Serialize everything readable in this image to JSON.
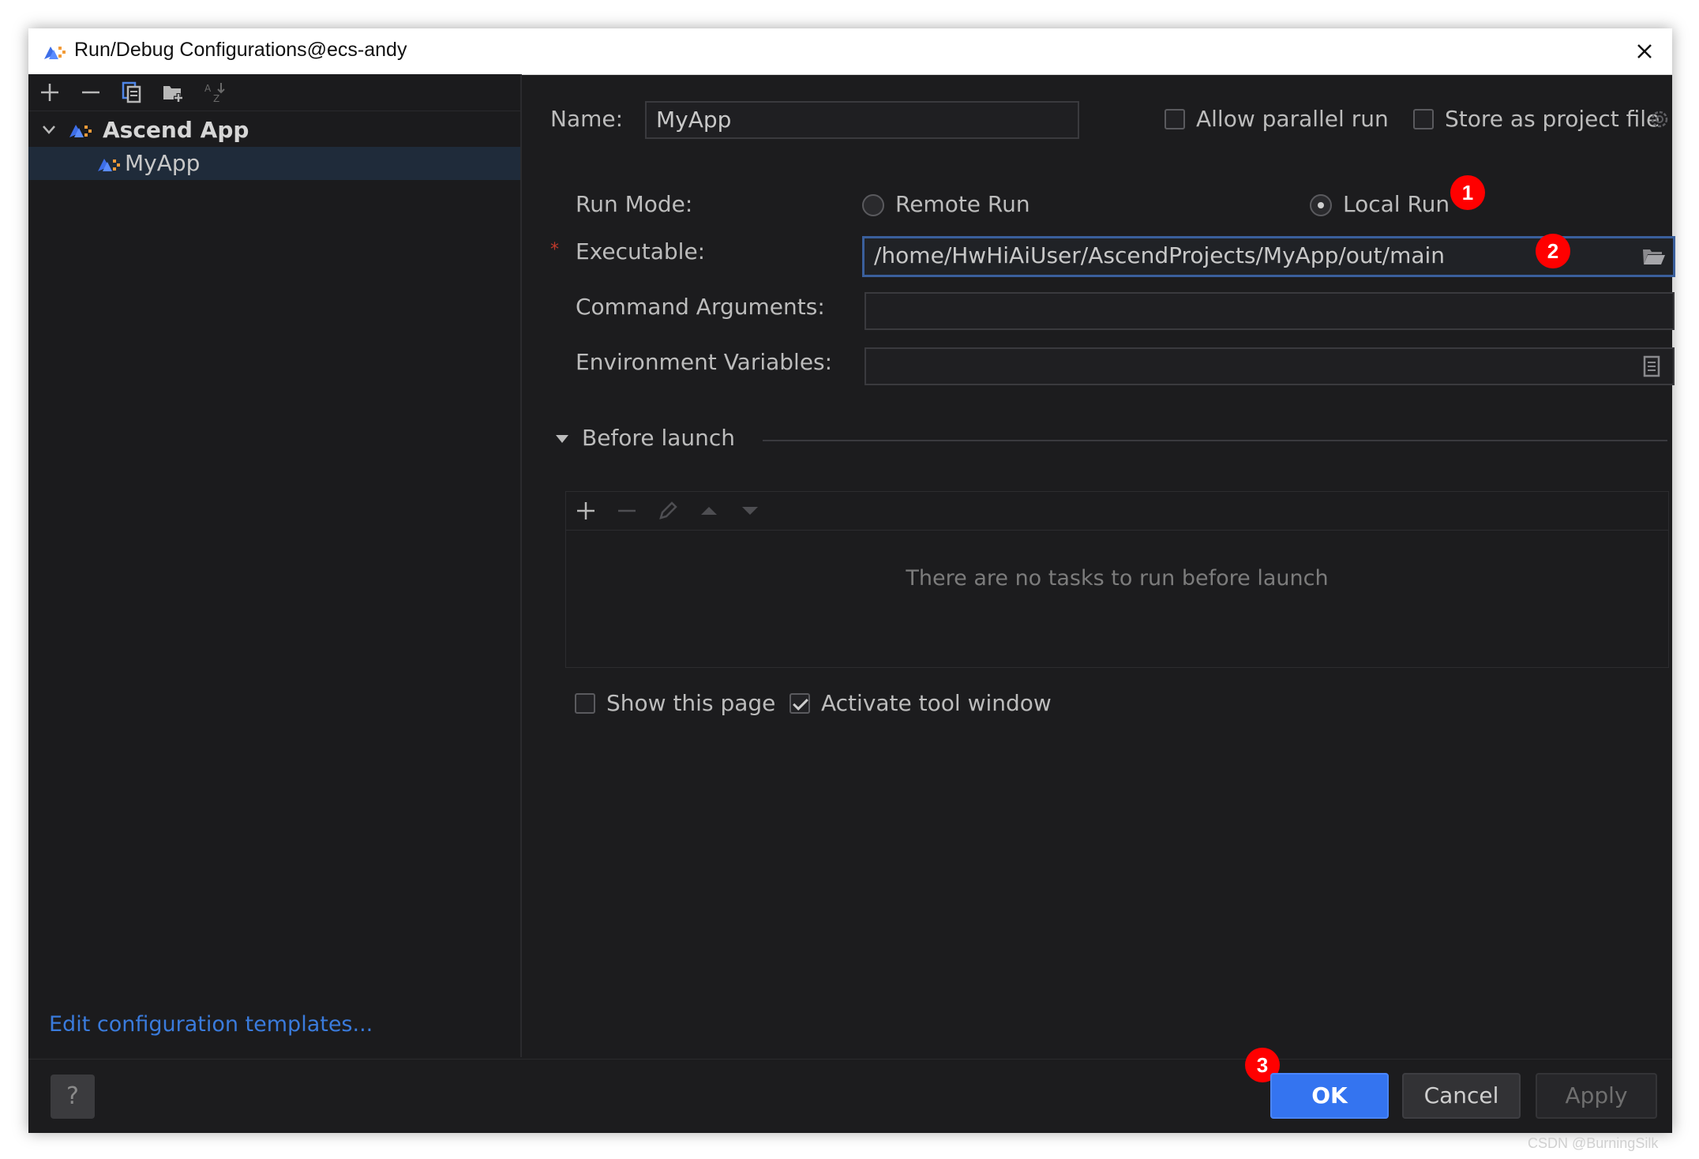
{
  "window": {
    "title": "Run/Debug Configurations@ecs-andy",
    "app_icon": "ascend-app-icon",
    "close_icon": "close-icon"
  },
  "left_panel": {
    "toolbar_icons": [
      "add-icon",
      "remove-icon",
      "copy-icon",
      "folder-add-icon",
      "sort-icon"
    ],
    "tree": {
      "group_label": "Ascend App",
      "item_label": "MyApp"
    },
    "edit_templates_link": "Edit configuration templates..."
  },
  "form": {
    "name_label": "Name:",
    "name_value": "MyApp",
    "allow_parallel_label": "Allow parallel run",
    "allow_parallel_checked": false,
    "store_project_label": "Store as project file",
    "store_project_checked": false,
    "run_mode_label": "Run Mode:",
    "remote_run_label": "Remote Run",
    "local_run_label": "Local Run",
    "selected_mode": "Local Run",
    "executable_required_marker": "*",
    "executable_label": "Executable:",
    "executable_value": "/home/HwHiAiUser/AscendProjects/MyApp/out/main",
    "command_args_label": "Command Arguments:",
    "command_args_value": "",
    "env_vars_label": "Environment Variables:",
    "env_vars_value": ""
  },
  "before_launch": {
    "title": "Before launch",
    "toolbar_icons": [
      "add-icon",
      "remove-icon",
      "edit-icon",
      "move-up-icon",
      "move-down-icon"
    ],
    "empty_message": "There are no tasks to run before launch",
    "show_page_label": "Show this page",
    "show_page_checked": false,
    "activate_tool_label": "Activate tool window",
    "activate_tool_checked": true
  },
  "annotations": {
    "badge_1": "1",
    "badge_2": "2",
    "badge_3": "3"
  },
  "footer": {
    "help_label": "?",
    "ok_label": "OK",
    "cancel_label": "Cancel",
    "apply_label": "Apply"
  },
  "watermark": "CSDN @BurningSilk",
  "colors": {
    "window_bg": "#1c1c1e",
    "accent_blue": "#3474f0",
    "link_blue": "#3a7bdc",
    "badge_red": "#ff0000",
    "required_red": "#c0392b"
  }
}
